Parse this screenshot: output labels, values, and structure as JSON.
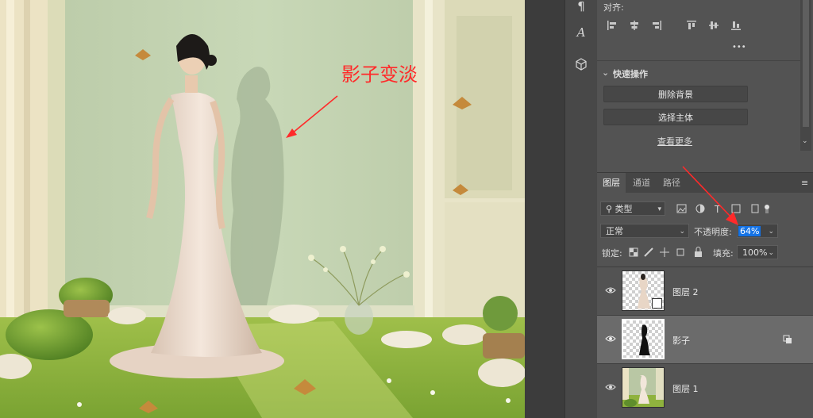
{
  "canvas": {
    "annotation": "影子变淡",
    "colors": {
      "annotation": "#ff2a2a",
      "arrow": "#ff2a2a"
    }
  },
  "toolstrip": {
    "icons": [
      "paragraph-icon",
      "character-icon",
      "3d-cube-icon"
    ]
  },
  "properties": {
    "align_label": "对齐:",
    "more": "•••",
    "quick_actions": {
      "title": "快速操作",
      "remove_bg": "删除背景",
      "select_subject": "选择主体",
      "see_more": "查看更多"
    }
  },
  "layers_panel": {
    "tabs": [
      "图层",
      "通道",
      "路径"
    ],
    "filter_kind": "类型",
    "blend_mode": "正常",
    "opacity_label": "不透明度:",
    "opacity_value": "64%",
    "lock_label": "锁定:",
    "fill_label": "填充:",
    "fill_value": "100%",
    "layers": [
      {
        "name": "图层 2",
        "selected": false
      },
      {
        "name": "影子",
        "selected": true
      },
      {
        "name": "图层 1",
        "selected": false
      }
    ]
  }
}
